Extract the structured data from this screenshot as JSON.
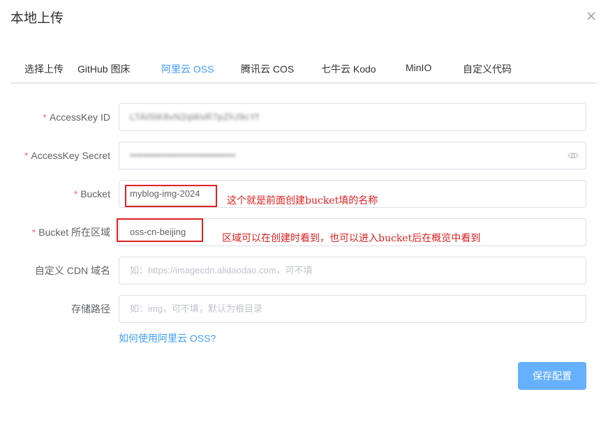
{
  "dialog": {
    "title": "本地上传"
  },
  "tabs": [
    {
      "label": "选择上传"
    },
    {
      "label": "GitHub 图床"
    },
    {
      "label": "阿里云 OSS",
      "active": true
    },
    {
      "label": "腾讯云 COS"
    },
    {
      "label": "七牛云 Kodo"
    },
    {
      "label": "MinIO"
    },
    {
      "label": "自定义代码"
    }
  ],
  "form": {
    "access_key_id": {
      "label": "AccessKey ID",
      "required": "*",
      "value": "LTAI5tK8vN2qWxR7pZhJ9cYf"
    },
    "access_key_secret": {
      "label": "AccessKey Secret",
      "required": "*",
      "value": "••••••••••••••••••••••••••••••"
    },
    "bucket": {
      "label": "Bucket",
      "required": "*",
      "value": "myblog-img-2024"
    },
    "region": {
      "label": "Bucket 所在区域",
      "required": "*",
      "value": "oss-cn-beijing"
    },
    "cdn_domain": {
      "label": "自定义 CDN 域名",
      "placeholder": "如：https://imagecdn.alidaodao.com，可不填"
    },
    "storage_path": {
      "label": "存储路径",
      "placeholder": "如：img，可不填，默认为根目录"
    }
  },
  "annotations": {
    "bucket_note": "这个就是前面创建bucket填的名称",
    "region_note": "区域可以在创建时看到，也可以进入bucket后在概览中看到"
  },
  "help_link": "如何使用阿里云 OSS?",
  "save_button": "保存配置",
  "colors": {
    "accent": "#409eff",
    "button": "#66b1ff",
    "required": "#f56c6c",
    "annotation": "#e02020"
  }
}
